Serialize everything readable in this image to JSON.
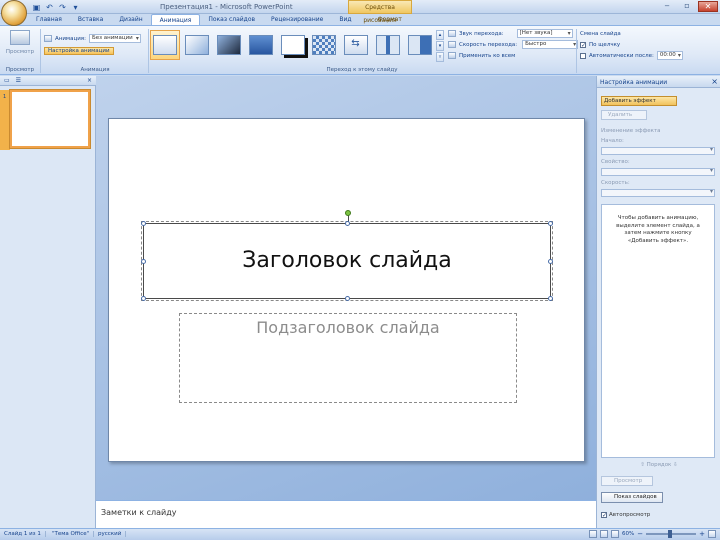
{
  "app": {
    "title": "Презентация1 - Microsoft PowerPoint",
    "context_tab_header": "Средства рисования"
  },
  "qat": {
    "save_icon": "save-icon",
    "undo_icon": "undo-icon",
    "redo_icon": "redo-icon",
    "customize_icon": "customize-icon"
  },
  "window_controls": {
    "minimize": "‒",
    "maximize": "▫",
    "close": "✕"
  },
  "ribbon_tabs": [
    {
      "label": "Главная"
    },
    {
      "label": "Вставка"
    },
    {
      "label": "Дизайн"
    },
    {
      "label": "Анимация"
    },
    {
      "label": "Показ слайдов"
    },
    {
      "label": "Рецензирование"
    },
    {
      "label": "Вид"
    },
    {
      "label": "Формат"
    }
  ],
  "ribbon": {
    "preview": {
      "label": "Просмотр",
      "group": "Просмотр"
    },
    "animation": {
      "animate_label": "Анимация:",
      "animate_value": "Без анимации",
      "custom_label": "Настройка анимации",
      "group": "Анимация"
    },
    "transition": {
      "sound_label": "Звук перехода:",
      "sound_value": "[Нет звука]",
      "speed_label": "Скорость перехода:",
      "speed_value": "Быстро",
      "apply_all_label": "Применить ко всем",
      "group": "Переход к этому слайду"
    },
    "advance": {
      "title": "Смена слайда",
      "on_click_label": "По щелчку",
      "auto_label": "Автоматически после:",
      "auto_value": "00:00"
    }
  },
  "left_pane": {
    "slides_tab_icon": "slides-tab-icon",
    "outline_tab_icon": "outline-tab-icon",
    "close": "×",
    "slide_number": "1"
  },
  "slide": {
    "title": "Заголовок слайда",
    "subtitle": "Подзаголовок слайда"
  },
  "notes": {
    "placeholder": "Заметки к слайду"
  },
  "task_pane": {
    "title": "Настройка анимации",
    "close": "×",
    "add_effect": "Добавить эффект",
    "remove": "Удалить",
    "modify_header": "Изменение эффекта",
    "start_label": "Начало:",
    "property_label": "Свойство:",
    "speed_label": "Скорость:",
    "hint": "Чтобы добавить анимацию, выделите элемент слайда, а затем нажмите кнопку «Добавить эффект».",
    "reorder_label": "Порядок",
    "play_label": "Просмотр",
    "slideshow_label": "Показ слайдов",
    "autopreview_label": "Автопросмотр"
  },
  "status_bar": {
    "slide_info": "Слайд 1 из 1",
    "theme": "\"Тема Office\"",
    "language": "русский",
    "zoom": "60%"
  }
}
